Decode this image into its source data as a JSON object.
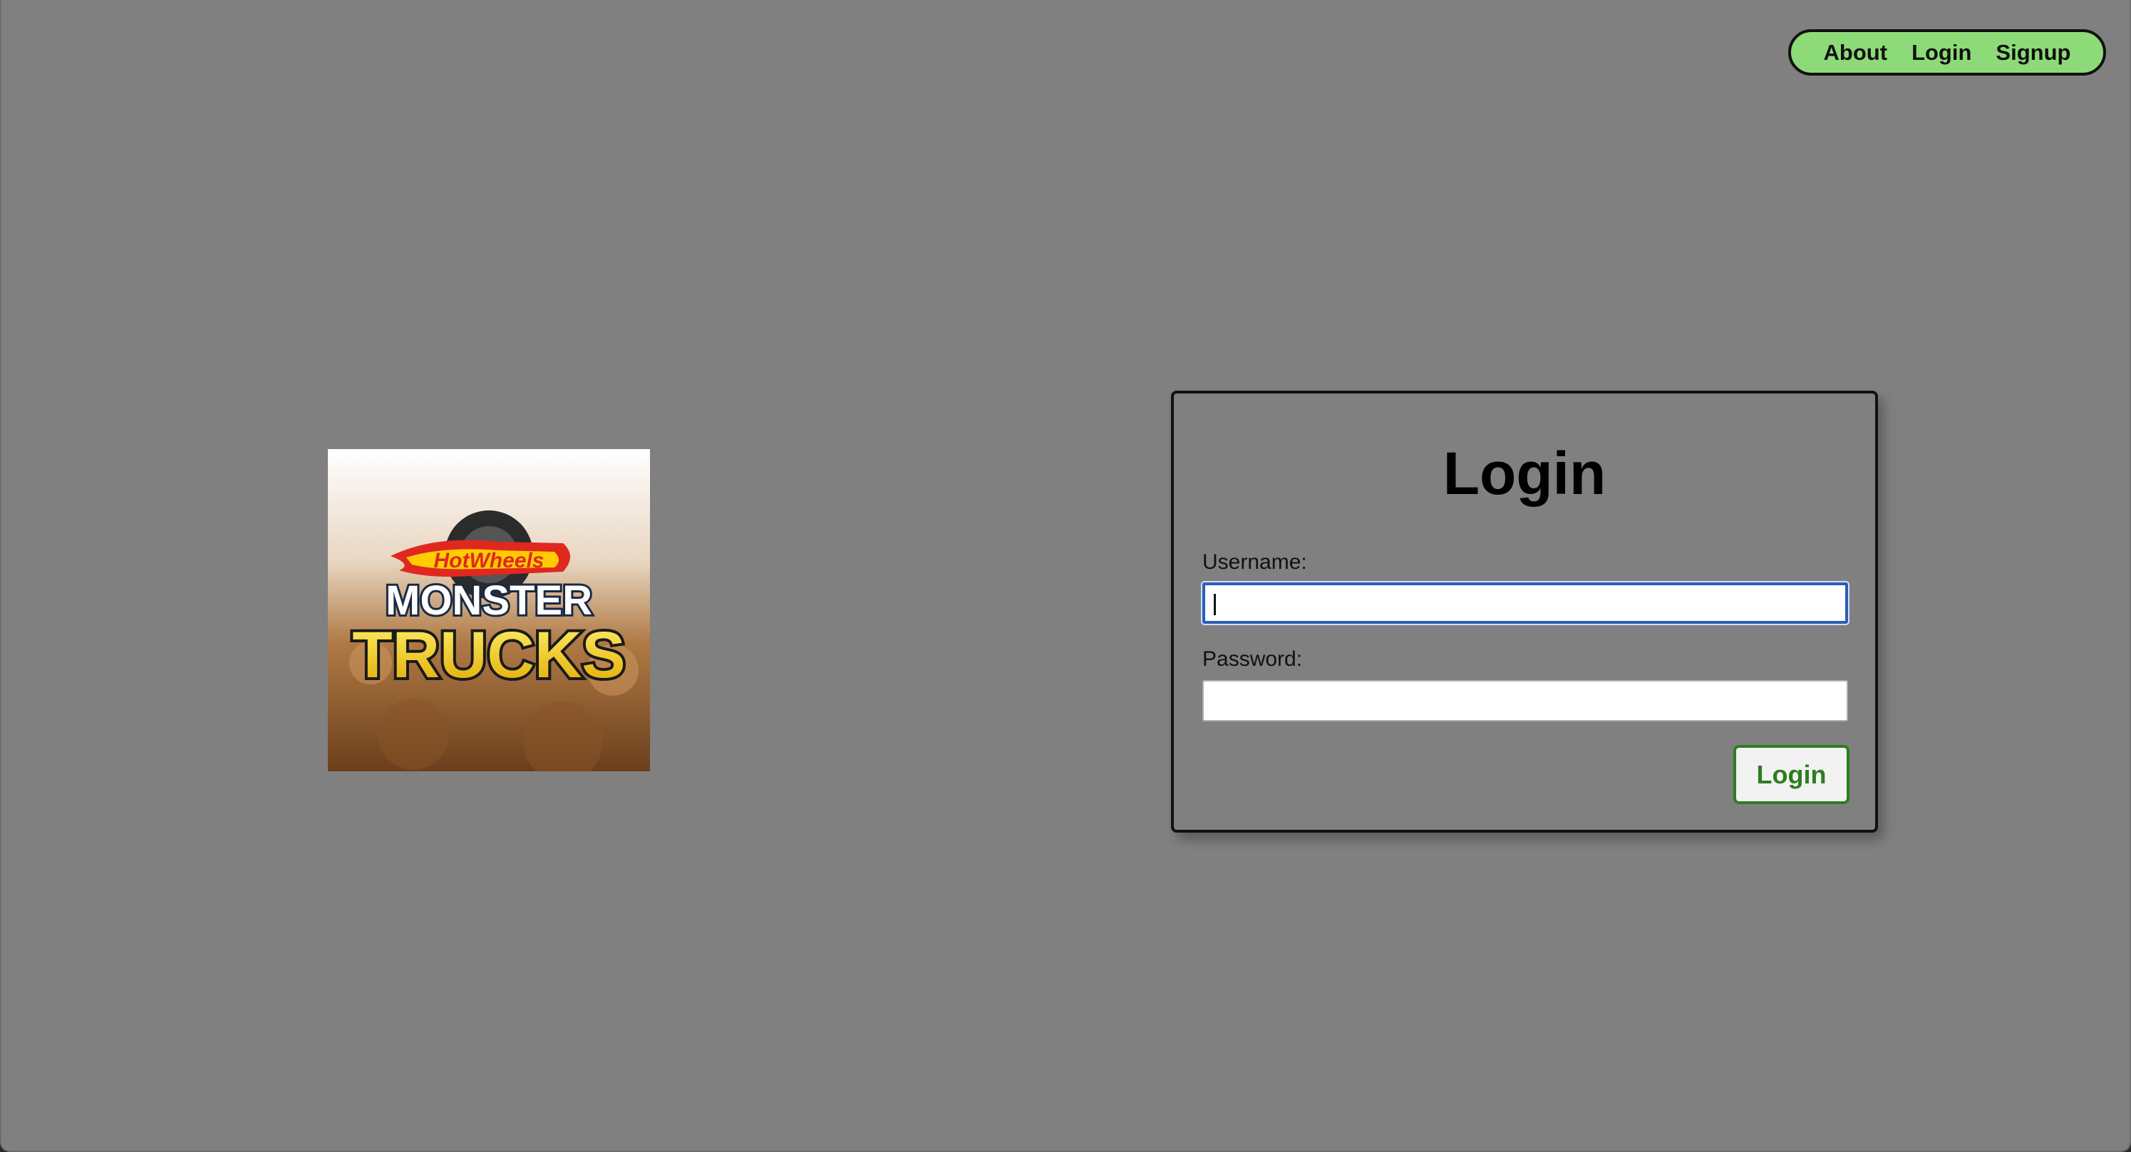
{
  "nav": {
    "items": [
      {
        "label": "About"
      },
      {
        "label": "Login"
      },
      {
        "label": "Signup"
      }
    ],
    "background_color": "#8ddb78"
  },
  "logo": {
    "top_word": "HotWheels",
    "line1": "MONSTER",
    "line2": "TRUCKS"
  },
  "login": {
    "title": "Login",
    "username_label": "Username:",
    "username_value": "",
    "password_label": "Password:",
    "password_value": "",
    "submit_label": "Login",
    "accent_color": "#2e7d1f"
  },
  "page": {
    "background_color": "#808080"
  }
}
